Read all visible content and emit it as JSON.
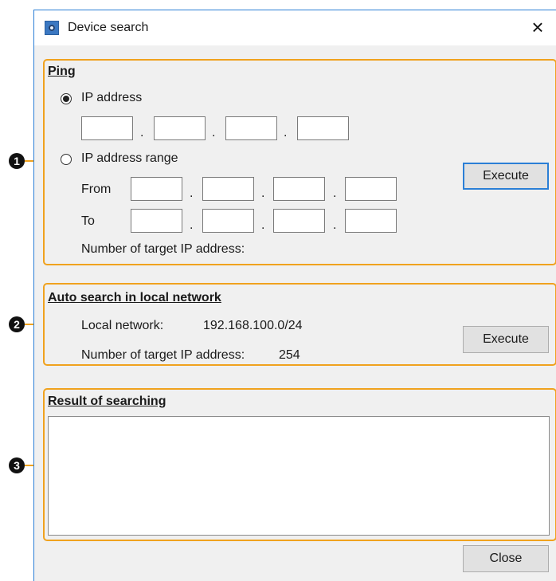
{
  "window": {
    "title": "Device search",
    "close_glyph": "×",
    "app_icon": "device-search-app-icon"
  },
  "callouts": [
    "1",
    "2",
    "3"
  ],
  "ping": {
    "title": "Ping",
    "ip_address_label": "IP address",
    "ip_address_selected": true,
    "ip_address_octets": [
      "",
      "",
      "",
      ""
    ],
    "range_label": "IP address range",
    "range_selected": false,
    "from_label": "From",
    "from_octets": [
      "",
      "",
      "",
      ""
    ],
    "to_label": "To",
    "to_octets": [
      "",
      "",
      "",
      ""
    ],
    "separator": ".",
    "target_count_label": "Number of target IP address:",
    "execute_label": "Execute"
  },
  "auto_search": {
    "title": "Auto search in local network",
    "local_network_label": "Local network:",
    "local_network_value": "192.168.100.0/24",
    "target_count_label": "Number of target IP address:",
    "target_count_value": "254",
    "execute_label": "Execute"
  },
  "result": {
    "title": "Result of searching",
    "content": ""
  },
  "footer": {
    "close_label": "Close"
  },
  "colors": {
    "callout_border": "#f0a21e",
    "focus_border": "#2b7fd6"
  }
}
